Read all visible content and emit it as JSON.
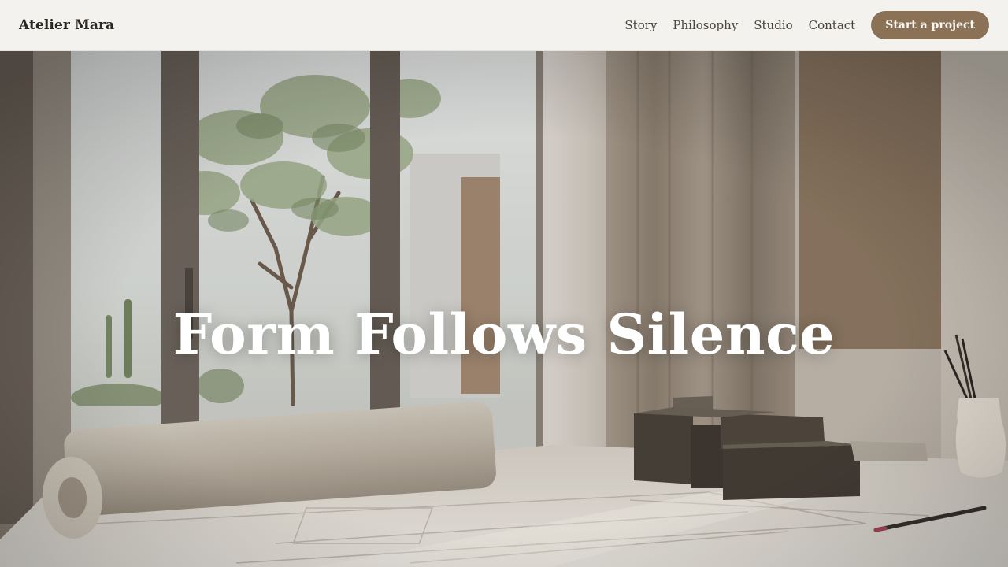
{
  "brand": {
    "name": "Atelier Mara"
  },
  "nav": {
    "links": [
      "Story",
      "Philosophy",
      "Studio",
      "Contact"
    ],
    "cta_label": "Start a project"
  },
  "hero": {
    "title": "Form Follows Silence",
    "image": "architect-studio-interior-with-courtyard-tree"
  },
  "colors": {
    "nav_background": "#f4f2ee",
    "cta_background": "#8b7256",
    "title_text": "#ffffff"
  }
}
